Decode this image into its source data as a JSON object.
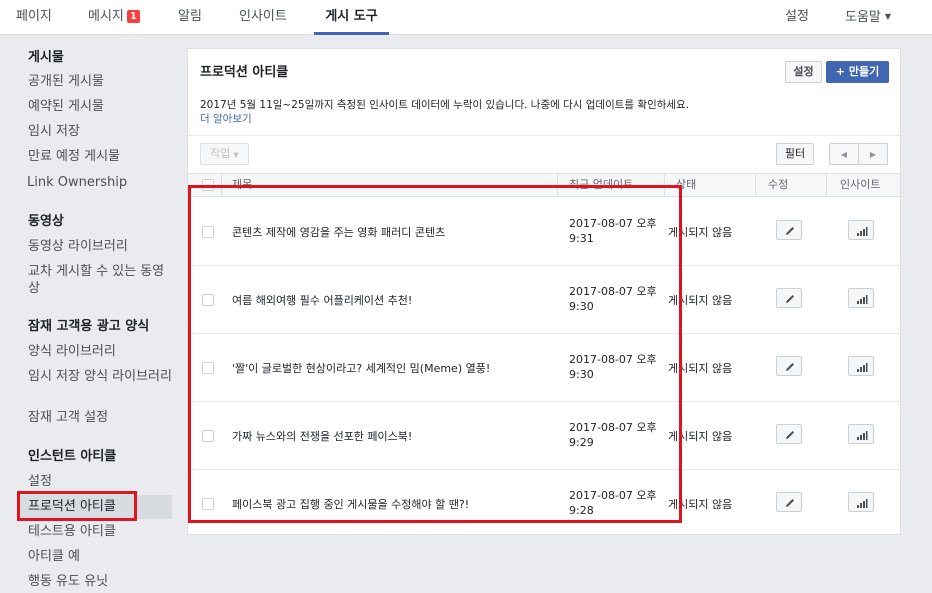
{
  "topnav": {
    "tabs": [
      {
        "label": "페이지"
      },
      {
        "label": "메시지",
        "badge": "1"
      },
      {
        "label": "알림"
      },
      {
        "label": "인사이트"
      },
      {
        "label": "게시 도구",
        "active": true
      }
    ],
    "settings_label": "설정",
    "help_label": "도움말"
  },
  "sidebar": {
    "sections": [
      {
        "header": "게시물",
        "items": [
          "공개된 게시물",
          "예약된 게시물",
          "임시 저장",
          "만료 예정 게시물",
          "Link Ownership"
        ]
      },
      {
        "header": "동영상",
        "items": [
          "동영상 라이브러리",
          "교차 게시할 수 있는 동영상"
        ]
      },
      {
        "header": "잠재 고객용 광고 양식",
        "items": [
          "양식 라이브러리",
          "임시 저장 양식 라이브러리",
          "잠재 고객 설정"
        ]
      },
      {
        "header": "인스턴트 아티클",
        "items": [
          "설정",
          "프로덕션 아티클",
          "테스트용 아티클",
          "아티클 예",
          "행동 유도 유닛"
        ]
      }
    ],
    "selected_item": "프로덕션 아티클"
  },
  "panel": {
    "title": "프로덕션 아티클",
    "settings_button": "설정",
    "create_button": "+ 만들기",
    "notice": "2017년 5월 11일~25일까지 측정된 인사이트 데이터에 누락이 있습니다. 나중에 다시 업데이트를 확인하세요.",
    "learn_more": "더 알아보기",
    "action_button": "작업",
    "filter_button": "필터",
    "columns": {
      "title": "제목",
      "updated": "최근 업데이트",
      "status": "상태",
      "edit": "수정",
      "insights": "인사이트"
    },
    "rows": [
      {
        "title": "콘텐츠 제작에 영감을 주는 영화 패러디 콘텐츠",
        "date": "2017-08-07 오후",
        "time": "9:31",
        "status": "게시되지 않음"
      },
      {
        "title": "여름 해외여행 필수 어플리케이션 추천!",
        "date": "2017-08-07 오후",
        "time": "9:30",
        "status": "게시되지 않음"
      },
      {
        "title": "'짤'이 글로벌한 현상이라고? 세계적인 밈(Meme) 열풍!",
        "date": "2017-08-07 오후",
        "time": "9:30",
        "status": "게시되지 않음"
      },
      {
        "title": "가짜 뉴스와의 전쟁을 선포한 페이스북!",
        "date": "2017-08-07 오후",
        "time": "9:29",
        "status": "게시되지 않음"
      },
      {
        "title": "페이스북 광고 집행 중인 게시물을 수정해야 할 땐?!",
        "date": "2017-08-07 오후",
        "time": "9:28",
        "status": "게시되지 않음"
      }
    ]
  },
  "colors": {
    "accent": "#4267b2",
    "highlight": "#e0141e",
    "badge": "#fa3e3e"
  }
}
